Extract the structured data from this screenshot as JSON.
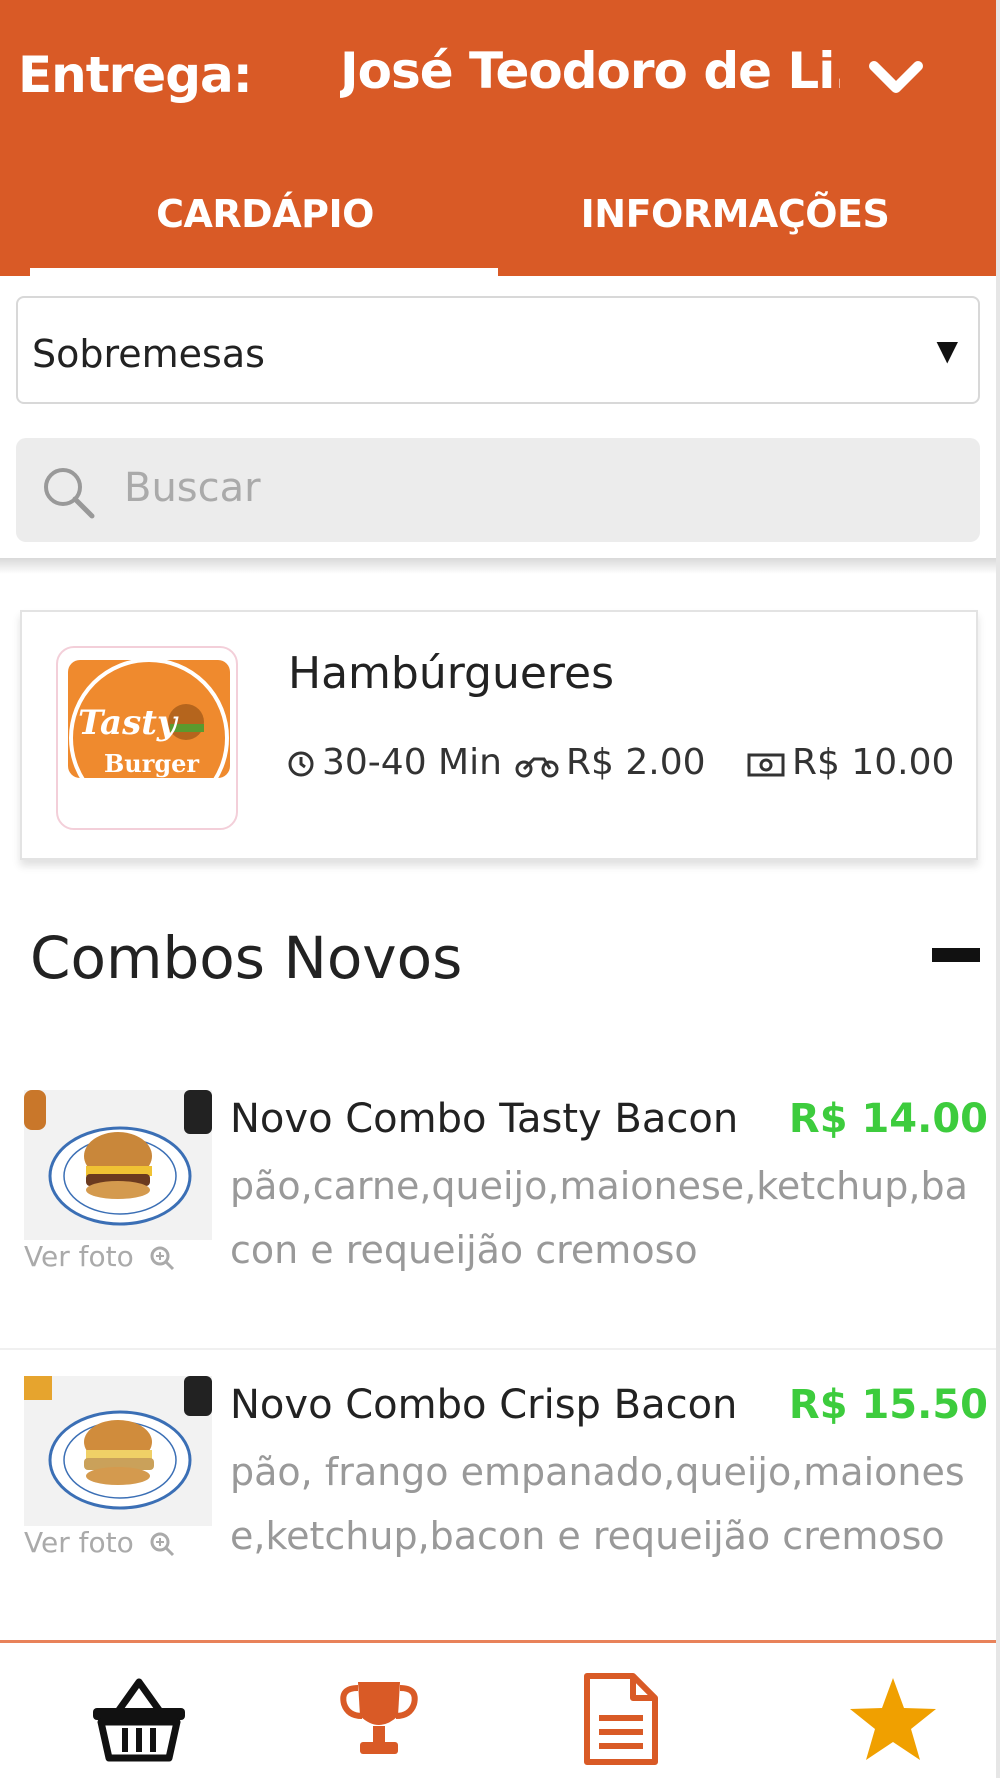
{
  "header": {
    "delivery_label": "Entrega:",
    "delivery_address": "José Teodoro de Li...",
    "chevron_icon": "chevron-down-icon",
    "background_color": "#d95a26"
  },
  "tabs": [
    {
      "label": "CARDÁPIO",
      "active": true
    },
    {
      "label": "INFORMAÇÕES",
      "active": false
    }
  ],
  "filters": {
    "category_selected": "Sobremesas",
    "search_placeholder": "Buscar"
  },
  "store": {
    "name": "Hambúrgueres",
    "delivery_time": "30-40 Min",
    "delivery_fee": "R$ 2.00",
    "minimum_order": "R$ 10.00"
  },
  "section": {
    "title": "Combos Novos"
  },
  "products": [
    {
      "name": "Novo Combo Tasty Bacon",
      "price": "R$ 14.00",
      "description": "pão,carne,queijo,maionese,ketchup,bacon e requeijão cremoso",
      "photo_link": "Ver foto"
    },
    {
      "name": "Novo Combo Crisp Bacon",
      "price": "R$ 15.50",
      "description": "pão, frango empanado,queijo,maionese,ketchup,bacon e requeijão cremoso",
      "photo_link": "Ver foto"
    }
  ],
  "bottom_nav": [
    {
      "icon": "basket-icon",
      "color": "#111111"
    },
    {
      "icon": "trophy-icon",
      "color": "#d95a26"
    },
    {
      "icon": "document-icon",
      "color": "#d95a26"
    },
    {
      "icon": "star-icon",
      "color": "#f0a000"
    }
  ],
  "colors": {
    "accent": "#d95a26",
    "price": "#3dcc3d"
  }
}
